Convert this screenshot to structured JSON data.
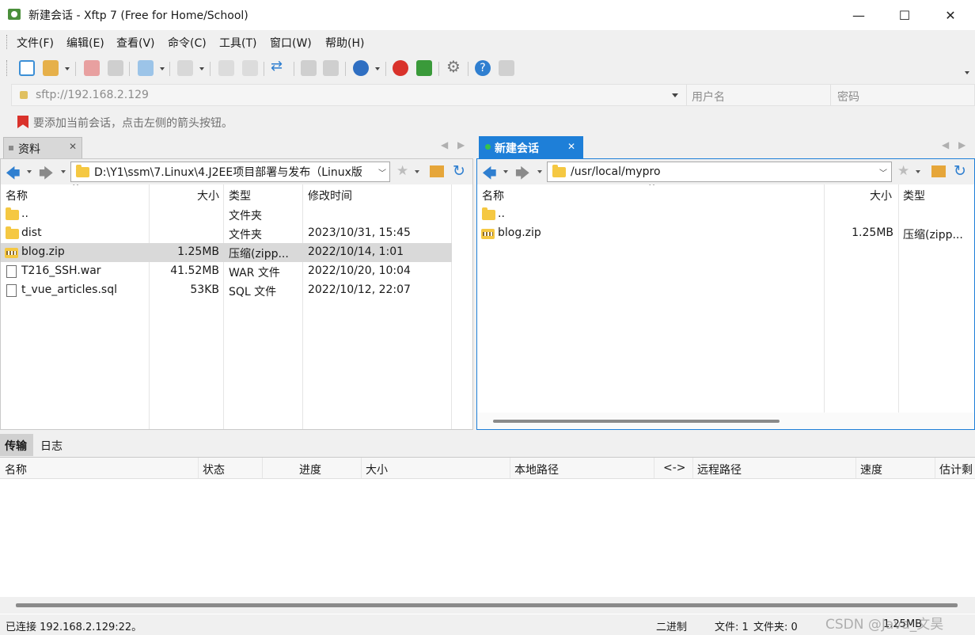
{
  "window": {
    "title": "新建会话 - Xftp 7 (Free for Home/School)",
    "minimize": "—",
    "maximize": "☐",
    "close": "✕"
  },
  "menu": [
    "文件(F)",
    "编辑(E)",
    "查看(V)",
    "命令(C)",
    "工具(T)",
    "窗口(W)",
    "帮助(H)"
  ],
  "address": {
    "value": "sftp://192.168.2.129",
    "user_placeholder": "用户名",
    "pass_placeholder": "密码"
  },
  "hint": "要添加当前会话，点击左侧的箭头按钮。",
  "left_pane": {
    "tab": "资料",
    "path": "D:\\Y1\\ssm\\7.Linux\\4.J2EE项目部署与发布（Linux版",
    "columns": [
      "名称",
      "大小",
      "类型",
      "修改时间"
    ],
    "rows": [
      {
        "name": "..",
        "size": "",
        "type": "文件夹",
        "modified": "",
        "icon": "folder-icon"
      },
      {
        "name": "dist",
        "size": "",
        "type": "文件夹",
        "modified": "2023/10/31, 15:45",
        "icon": "folder-icon"
      },
      {
        "name": "blog.zip",
        "size": "1.25MB",
        "type": "压缩(zipp...",
        "modified": "2022/10/14, 1:01",
        "icon": "zip-icon",
        "selected": true
      },
      {
        "name": "T216_SSH.war",
        "size": "41.52MB",
        "type": "WAR 文件",
        "modified": "2022/10/20, 10:04",
        "icon": "file-icon"
      },
      {
        "name": "t_vue_articles.sql",
        "size": "53KB",
        "type": "SQL 文件",
        "modified": "2022/10/12, 22:07",
        "icon": "file-icon"
      }
    ]
  },
  "right_pane": {
    "tab": "新建会话",
    "path": "/usr/local/mypro",
    "columns": [
      "名称",
      "大小",
      "类型"
    ],
    "rows": [
      {
        "name": "..",
        "size": "",
        "type": "",
        "icon": "folder-icon"
      },
      {
        "name": "blog.zip",
        "size": "1.25MB",
        "type": "压缩(zipp...",
        "icon": "zip-icon"
      }
    ]
  },
  "transfer": {
    "tabs": [
      "传输",
      "日志"
    ],
    "columns": [
      "名称",
      "状态",
      "进度",
      "大小",
      "本地路径",
      "<->",
      "远程路径",
      "速度",
      "估计剩"
    ]
  },
  "status": {
    "connection": "已连接 192.168.2.129:22。",
    "mode": "二进制",
    "files": "文件: 1",
    "folders": "文件夹: 0",
    "size": "1.25MB",
    "watermark": "CSDN @Java_文昊"
  },
  "colors": {
    "accent": "#1e7fd8",
    "selected_row": "#d9d9d9",
    "session_dot": "#36c24a"
  }
}
